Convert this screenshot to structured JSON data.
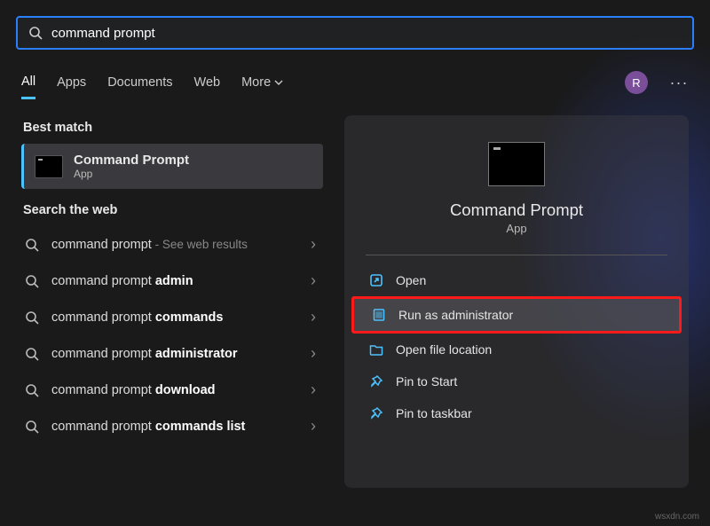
{
  "search": {
    "value": "command prompt"
  },
  "tabs": {
    "all": "All",
    "apps": "Apps",
    "documents": "Documents",
    "web": "Web",
    "more": "More"
  },
  "user": {
    "initial": "R"
  },
  "left": {
    "best_match_hdr": "Best match",
    "best": {
      "title": "Command Prompt",
      "sub": "App"
    },
    "web_hdr": "Search the web",
    "items": [
      {
        "pre": "command prompt",
        "bold": "",
        "hint": " - See web results"
      },
      {
        "pre": "command prompt ",
        "bold": "admin",
        "hint": ""
      },
      {
        "pre": "command prompt ",
        "bold": "commands",
        "hint": ""
      },
      {
        "pre": "command prompt ",
        "bold": "administrator",
        "hint": ""
      },
      {
        "pre": "command prompt ",
        "bold": "download",
        "hint": ""
      },
      {
        "pre": "command prompt ",
        "bold": "commands list",
        "hint": ""
      }
    ]
  },
  "right": {
    "title": "Command Prompt",
    "sub": "App",
    "actions": {
      "open": "Open",
      "run_admin": "Run as administrator",
      "file_loc": "Open file location",
      "pin_start": "Pin to Start",
      "pin_taskbar": "Pin to taskbar"
    }
  },
  "watermark": "wsxdn.com"
}
